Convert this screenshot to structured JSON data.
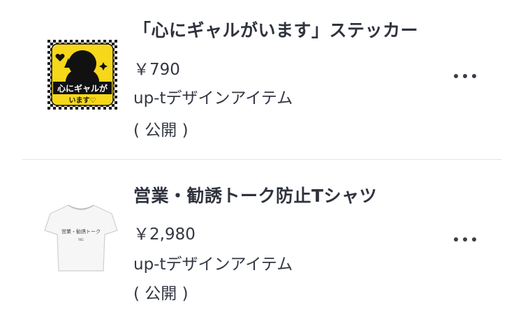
{
  "items": [
    {
      "title": "「心にギャルがいます」ステッカー",
      "price": "￥790",
      "shop": "up-tデザインアイテム",
      "status": "( 公開 )",
      "thumb_icon": "sticker-image",
      "thumb_text_1": "心にギャルが",
      "thumb_text_2": "います♡"
    },
    {
      "title": "営業・勧誘トーク防止Tシャツ",
      "price": "￥2,980",
      "shop": "up-tデザインアイテム",
      "status": "( 公開 )",
      "thumb_icon": "tshirt-image",
      "thumb_text_1": "営業・勧誘トーク",
      "thumb_text_2": "NG"
    }
  ],
  "colors": {
    "sticker_yellow": "#f6d71a",
    "text": "#2f333d",
    "divider": "#e3e4e7"
  }
}
